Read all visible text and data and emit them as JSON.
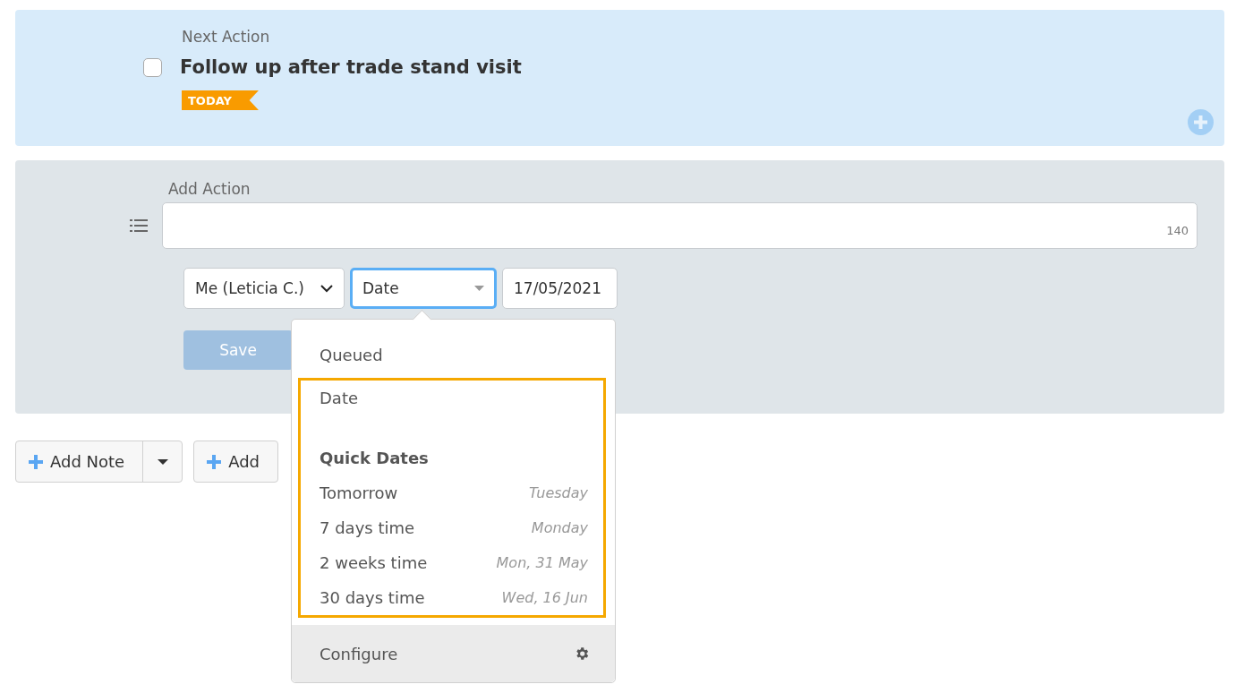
{
  "next_action": {
    "label": "Next Action",
    "checked": false,
    "title": "Follow up after trade stand visit",
    "badge": "TODAY"
  },
  "add_action": {
    "label": "Add Action",
    "char_count": "140",
    "assignee": {
      "value": "Me (Leticia C.)"
    },
    "date_type": {
      "value": "Date",
      "focused": true
    },
    "date": {
      "value": "17/05/2021"
    },
    "save_button": {
      "label": "Save",
      "disabled": true
    }
  },
  "date_menu": {
    "items": [
      {
        "kind": "option",
        "label": "Queued"
      }
    ],
    "highlighted_items": [
      {
        "kind": "option",
        "label": "Date"
      },
      {
        "kind": "heading",
        "label": "Quick Dates"
      },
      {
        "kind": "quick",
        "label": "Tomorrow",
        "hint": "Tuesday"
      },
      {
        "kind": "quick",
        "label": "7 days time",
        "hint": "Monday"
      },
      {
        "kind": "quick",
        "label": "2 weeks time",
        "hint": "Mon, 31 May"
      },
      {
        "kind": "quick",
        "label": "30 days time",
        "hint": "Wed, 16 Jun"
      }
    ],
    "footer": {
      "label": "Configure"
    }
  },
  "bottom_buttons": [
    {
      "label": "Add Note",
      "split": true
    },
    {
      "label": "Add",
      "split": false
    }
  ]
}
